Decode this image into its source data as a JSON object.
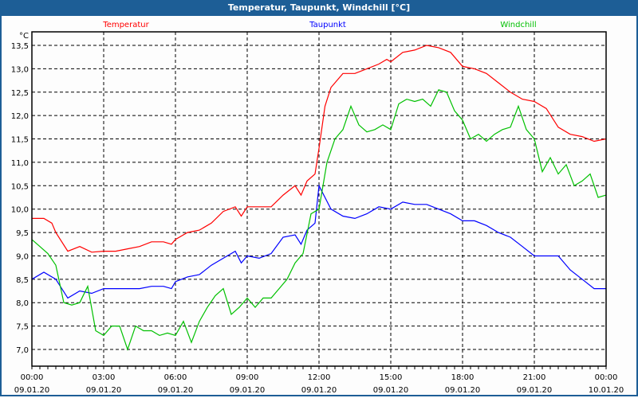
{
  "window": {
    "title": "Temperatur, Taupunkt, Windchill [°C]"
  },
  "chart_data": {
    "type": "line",
    "title": "Temperatur, Taupunkt, Windchill [°C]",
    "ylabel": "°C",
    "ylim": [
      6.75,
      13.75
    ],
    "yticks": [
      7.0,
      7.5,
      8.0,
      8.5,
      9.0,
      9.5,
      10.0,
      10.5,
      11.0,
      11.5,
      12.0,
      12.5,
      13.0,
      13.5
    ],
    "ytick_labels": [
      "7,0",
      "7,5",
      "8,0",
      "8,5",
      "9,0",
      "9,5",
      "10,0",
      "10,5",
      "11,0",
      "11,5",
      "12,0",
      "12,5",
      "13,0",
      "13,5"
    ],
    "xlim_minutes": [
      0,
      1440
    ],
    "xtick_labels": [
      {
        "time": "00:00",
        "date": "09.01.20"
      },
      {
        "time": "03:00",
        "date": "09.01.20"
      },
      {
        "time": "06:00",
        "date": "09.01.20"
      },
      {
        "time": "09:00",
        "date": "09.01.20"
      },
      {
        "time": "12:00",
        "date": "09.01.20"
      },
      {
        "time": "15:00",
        "date": "09.01.20"
      },
      {
        "time": "18:00",
        "date": "09.01.20"
      },
      {
        "time": "21:00",
        "date": "09.01.20"
      },
      {
        "time": "00:00",
        "date": "10.01.20"
      }
    ],
    "grid": true,
    "legend_placement": "top",
    "series": [
      {
        "name": "Temperatur",
        "color": "#ff0000",
        "x": [
          0,
          30,
          50,
          60,
          90,
          120,
          150,
          180,
          210,
          240,
          270,
          300,
          330,
          350,
          360,
          390,
          420,
          450,
          480,
          510,
          525,
          540,
          570,
          600,
          630,
          660,
          675,
          690,
          710,
          720,
          735,
          750,
          780,
          810,
          840,
          870,
          890,
          900,
          930,
          960,
          990,
          1020,
          1050,
          1080,
          1110,
          1140,
          1170,
          1200,
          1230,
          1260,
          1290,
          1320,
          1350,
          1380,
          1410,
          1440
        ],
        "y": [
          9.8,
          9.8,
          9.7,
          9.5,
          9.1,
          9.2,
          9.08,
          9.1,
          9.1,
          9.15,
          9.2,
          9.3,
          9.3,
          9.25,
          9.35,
          9.5,
          9.55,
          9.7,
          9.95,
          10.05,
          9.85,
          10.05,
          10.05,
          10.05,
          10.3,
          10.5,
          10.3,
          10.6,
          10.75,
          11.3,
          12.2,
          12.6,
          12.9,
          12.9,
          13.0,
          13.1,
          13.2,
          13.15,
          13.35,
          13.4,
          13.5,
          13.45,
          13.35,
          13.05,
          13.0,
          12.9,
          12.7,
          12.5,
          12.35,
          12.3,
          12.15,
          11.75,
          11.6,
          11.55,
          11.45,
          11.5
        ]
      },
      {
        "name": "Taupunkt",
        "color": "#0000ff",
        "x": [
          0,
          30,
          60,
          90,
          120,
          150,
          180,
          210,
          240,
          270,
          300,
          330,
          350,
          360,
          390,
          420,
          450,
          480,
          510,
          525,
          540,
          570,
          600,
          630,
          660,
          675,
          690,
          710,
          720,
          750,
          780,
          810,
          840,
          870,
          900,
          930,
          960,
          990,
          1020,
          1050,
          1080,
          1110,
          1140,
          1170,
          1200,
          1230,
          1260,
          1290,
          1320,
          1350,
          1380,
          1410,
          1440
        ],
        "y": [
          8.5,
          8.65,
          8.5,
          8.1,
          8.25,
          8.2,
          8.3,
          8.3,
          8.3,
          8.3,
          8.35,
          8.35,
          8.3,
          8.45,
          8.55,
          8.6,
          8.8,
          8.95,
          9.1,
          8.85,
          9.0,
          8.95,
          9.05,
          9.4,
          9.45,
          9.25,
          9.55,
          9.7,
          10.5,
          10.0,
          9.85,
          9.8,
          9.9,
          10.05,
          10.0,
          10.15,
          10.1,
          10.1,
          10.0,
          9.9,
          9.75,
          9.75,
          9.65,
          9.5,
          9.4,
          9.2,
          9.0,
          9.0,
          9.0,
          8.7,
          8.5,
          8.3,
          8.3
        ]
      },
      {
        "name": "Windchill",
        "color": "#00c000",
        "x": [
          0,
          20,
          40,
          60,
          80,
          100,
          120,
          140,
          160,
          180,
          200,
          220,
          240,
          260,
          280,
          300,
          320,
          340,
          360,
          380,
          400,
          420,
          440,
          460,
          480,
          500,
          520,
          540,
          560,
          580,
          600,
          620,
          640,
          660,
          680,
          700,
          720,
          740,
          760,
          780,
          800,
          820,
          840,
          860,
          880,
          900,
          920,
          940,
          960,
          980,
          1000,
          1020,
          1040,
          1060,
          1080,
          1100,
          1120,
          1140,
          1160,
          1180,
          1200,
          1220,
          1240,
          1260,
          1280,
          1300,
          1320,
          1340,
          1360,
          1380,
          1400,
          1420,
          1440
        ],
        "y": [
          9.35,
          9.2,
          9.05,
          8.8,
          8.0,
          7.95,
          8.0,
          8.35,
          7.4,
          7.3,
          7.5,
          7.5,
          7.0,
          7.5,
          7.4,
          7.4,
          7.3,
          7.35,
          7.3,
          7.6,
          7.15,
          7.6,
          7.9,
          8.15,
          8.3,
          7.75,
          7.9,
          8.1,
          7.9,
          8.1,
          8.1,
          8.3,
          8.5,
          8.85,
          9.05,
          9.9,
          10.0,
          11.0,
          11.5,
          11.7,
          12.2,
          11.8,
          11.65,
          11.7,
          11.8,
          11.7,
          12.25,
          12.35,
          12.3,
          12.35,
          12.2,
          12.55,
          12.5,
          12.1,
          11.9,
          11.5,
          11.6,
          11.45,
          11.6,
          11.7,
          11.75,
          12.2,
          11.7,
          11.5,
          10.8,
          11.1,
          10.75,
          10.95,
          10.5,
          10.6,
          10.75,
          10.25,
          10.3
        ]
      }
    ]
  }
}
